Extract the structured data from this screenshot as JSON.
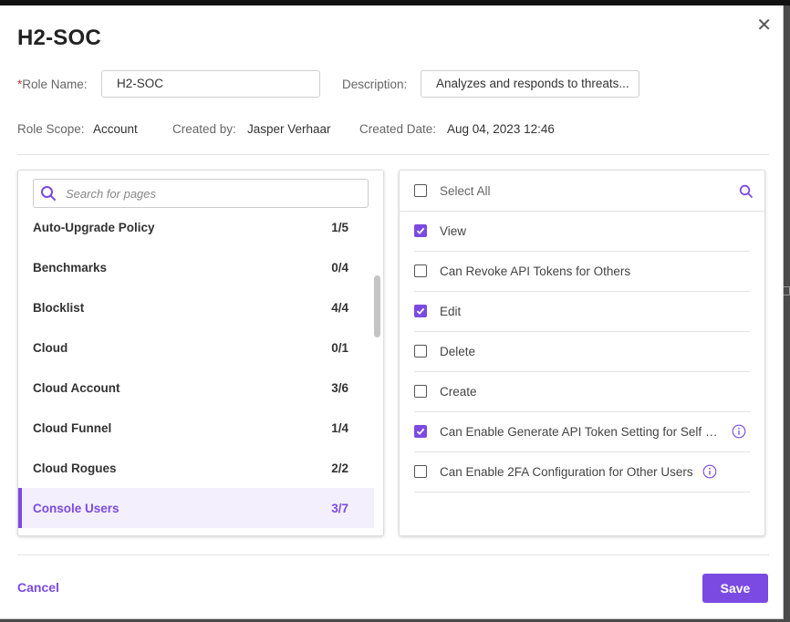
{
  "modal": {
    "title": "H2-SOC",
    "close_glyph": "✕"
  },
  "form": {
    "role_name_required_mark": "*",
    "role_name_label": "Role Name:",
    "role_name_value": "H2-SOC",
    "description_label": "Description:",
    "description_value": "Analyzes and responds to threats...",
    "role_scope_label": "Role Scope:",
    "role_scope_value": "Account",
    "created_by_label": "Created by:",
    "created_by_value": "Jasper Verhaar",
    "created_date_label": "Created Date:",
    "created_date_value": "Aug 04, 2023 12:46"
  },
  "pages": {
    "search_placeholder": "Search for pages",
    "items": [
      {
        "name": "Auto-Upgrade Policy",
        "count": "1/5",
        "active": false
      },
      {
        "name": "Benchmarks",
        "count": "0/4",
        "active": false
      },
      {
        "name": "Blocklist",
        "count": "4/4",
        "active": false
      },
      {
        "name": "Cloud",
        "count": "0/1",
        "active": false
      },
      {
        "name": "Cloud Account",
        "count": "3/6",
        "active": false
      },
      {
        "name": "Cloud Funnel",
        "count": "1/4",
        "active": false
      },
      {
        "name": "Cloud Rogues",
        "count": "2/2",
        "active": false
      },
      {
        "name": "Console Users",
        "count": "3/7",
        "active": true
      }
    ]
  },
  "permissions": {
    "select_all_label": "Select All",
    "items": [
      {
        "label": "View",
        "checked": true,
        "info": false
      },
      {
        "label": "Can Revoke API Tokens for Others",
        "checked": false,
        "info": false
      },
      {
        "label": "Edit",
        "checked": true,
        "info": false
      },
      {
        "label": "Delete",
        "checked": false,
        "info": false
      },
      {
        "label": "Create",
        "checked": false,
        "info": false
      },
      {
        "label": "Can Enable Generate API Token Setting for Self and ...",
        "checked": true,
        "info": true
      },
      {
        "label": "Can Enable 2FA Configuration for Other Users",
        "checked": false,
        "info": true
      }
    ]
  },
  "footer": {
    "cancel_label": "Cancel",
    "save_label": "Save"
  },
  "colors": {
    "accent": "#7b4ae2",
    "required": "#c0392b"
  },
  "icons": {
    "close": "close-icon",
    "search": "search-icon",
    "info": "info-icon",
    "check": "check-icon"
  }
}
